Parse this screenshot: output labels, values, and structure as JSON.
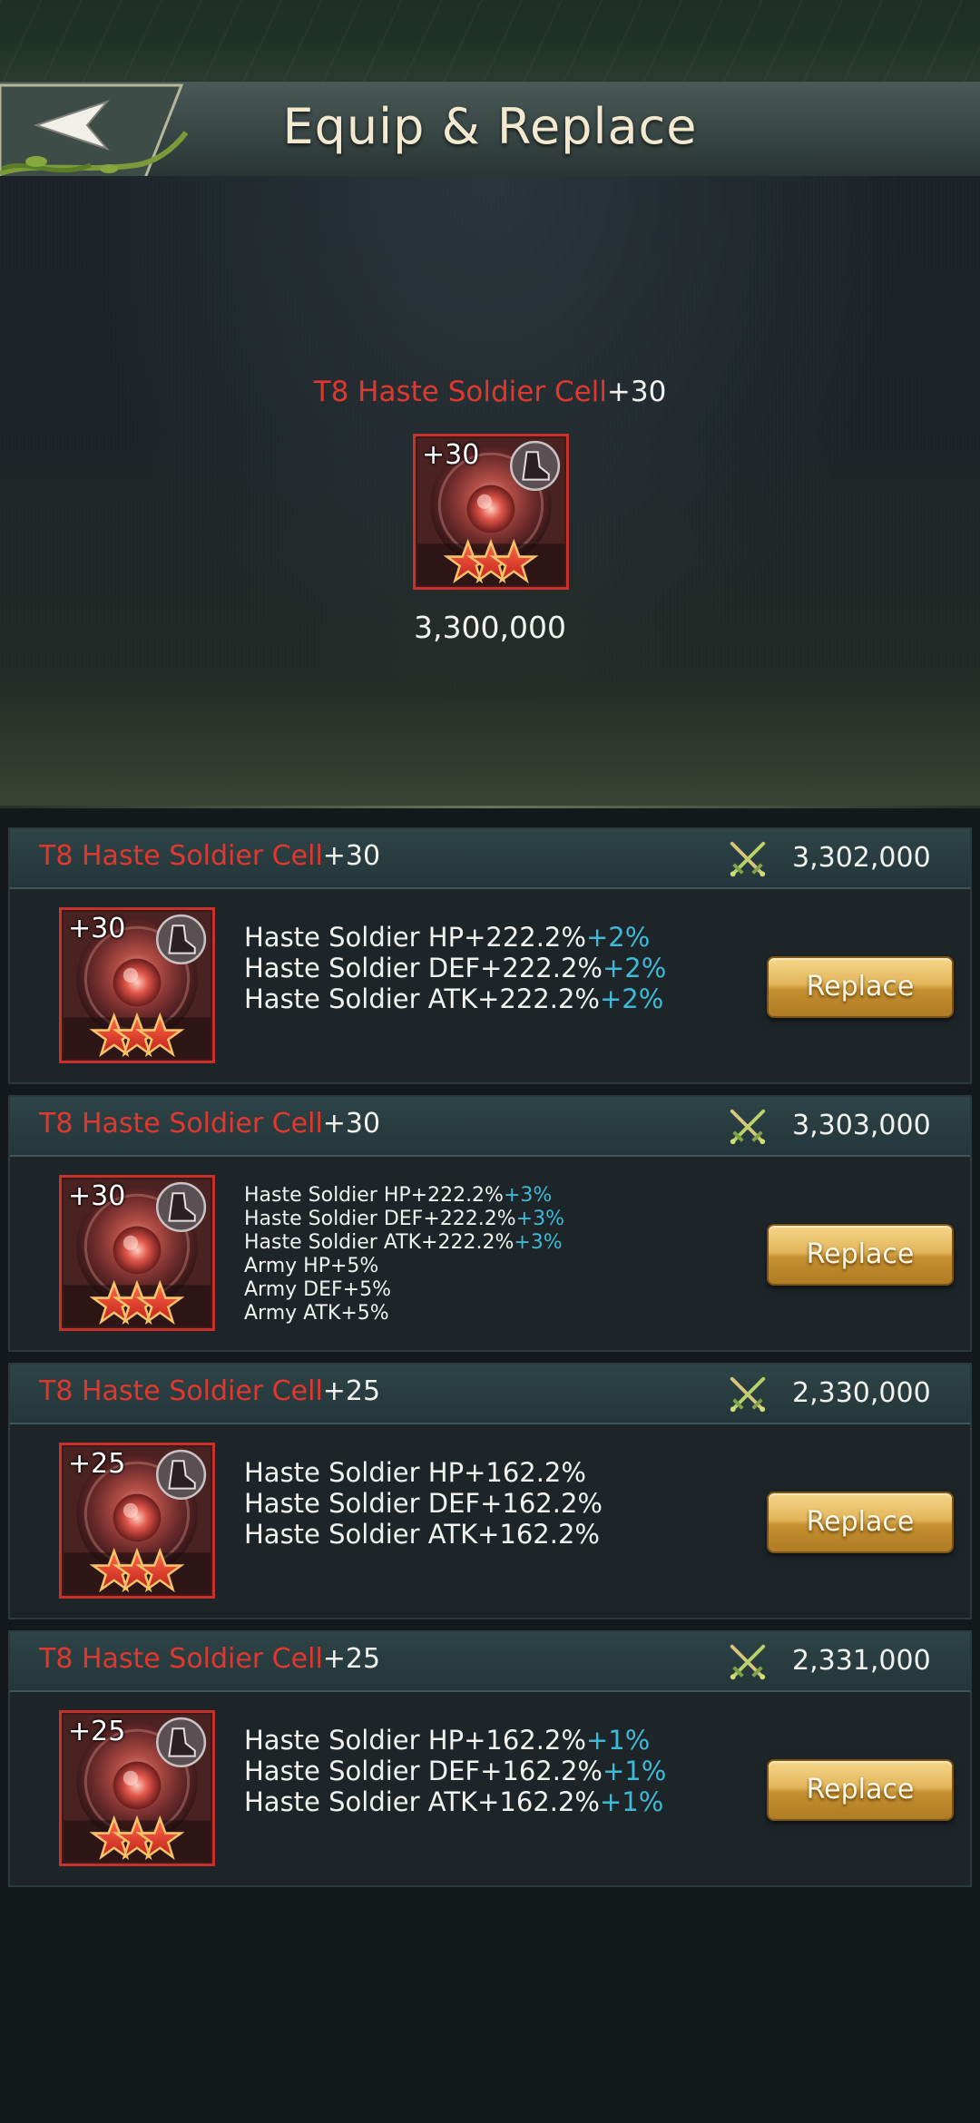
{
  "header": {
    "title": "Equip & Replace"
  },
  "preview": {
    "name": "T8 Haste Soldier Cell",
    "level": "+30",
    "icon_level": "+30",
    "power": "3,300,000"
  },
  "cards": [
    {
      "name": "T8 Haste Soldier Cell",
      "level": "+30",
      "icon_level": "+30",
      "power": "3,302,000",
      "stats": [
        {
          "label": "Haste Soldier HP+222.2%",
          "bonus": "+2%"
        },
        {
          "label": "Haste Soldier DEF+222.2%",
          "bonus": "+2%"
        },
        {
          "label": "Haste Soldier ATK+222.2%",
          "bonus": "+2%"
        }
      ],
      "button": "Replace"
    },
    {
      "name": "T8 Haste Soldier Cell",
      "level": "+30",
      "icon_level": "+30",
      "power": "3,303,000",
      "stats": [
        {
          "label": "Haste Soldier HP+222.2%",
          "bonus": "+3%"
        },
        {
          "label": "Haste Soldier DEF+222.2%",
          "bonus": "+3%"
        },
        {
          "label": "Haste Soldier ATK+222.2%",
          "bonus": "+3%"
        },
        {
          "label": "Army HP+5%",
          "bonus": ""
        },
        {
          "label": "Army DEF+5%",
          "bonus": ""
        },
        {
          "label": "Army ATK+5%",
          "bonus": ""
        }
      ],
      "button": "Replace"
    },
    {
      "name": "T8 Haste Soldier Cell",
      "level": "+25",
      "icon_level": "+25",
      "power": "2,330,000",
      "stats": [
        {
          "label": "Haste Soldier HP+162.2%",
          "bonus": ""
        },
        {
          "label": "Haste Soldier DEF+162.2%",
          "bonus": ""
        },
        {
          "label": "Haste Soldier ATK+162.2%",
          "bonus": ""
        }
      ],
      "button": "Replace"
    },
    {
      "name": "T8 Haste Soldier Cell",
      "level": "+25",
      "icon_level": "+25",
      "power": "2,331,000",
      "stats": [
        {
          "label": "Haste Soldier HP+162.2%",
          "bonus": "+1%"
        },
        {
          "label": "Haste Soldier DEF+162.2%",
          "bonus": "+1%"
        },
        {
          "label": "Haste Soldier ATK+162.2%",
          "bonus": "+1%"
        }
      ],
      "button": "Replace"
    }
  ],
  "colors": {
    "name_red": "#e0382f",
    "bonus_cyan": "#3fb9d8",
    "button_gold": "#e2b55a"
  },
  "icons": {
    "back": "back-arrow-icon",
    "power": "crossed-swords-icon",
    "item": "soldier-cell-icon",
    "boot": "boot-icon",
    "star": "star-icon"
  }
}
